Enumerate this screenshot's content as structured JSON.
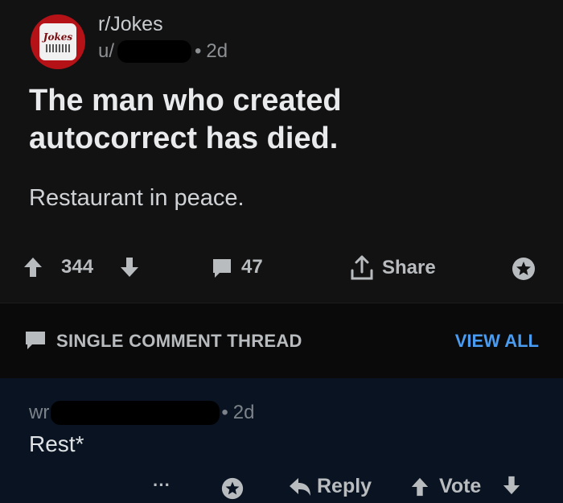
{
  "post": {
    "subreddit": "r/Jokes",
    "author_prefix": "u/",
    "age": "2d",
    "title": "The man who created autocorrect has died.",
    "body": "Restaurant in peace.",
    "upvotes": "344",
    "comments": "47",
    "share_label": "Share"
  },
  "thread_bar": {
    "label": "SINGLE COMMENT THREAD",
    "view_all": "VIEW ALL"
  },
  "comment": {
    "author_prefix": "wr",
    "age": "2d",
    "body": "Rest*",
    "more_label": "···",
    "reply_label": "Reply",
    "vote_label": "Vote"
  },
  "colors": {
    "post_bg": "#121213",
    "comment_bg": "#091321",
    "accent_link": "#4a9cf0",
    "avatar_red": "#b51218"
  },
  "icons": [
    "jokes-avatar",
    "upvote-icon",
    "downvote-icon",
    "comment-icon",
    "share-icon",
    "award-icon",
    "chat-icon",
    "reply-icon"
  ]
}
